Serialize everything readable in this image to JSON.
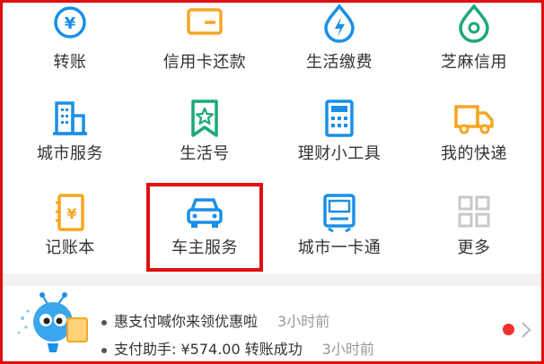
{
  "colors": {
    "accent_blue": "#1a8fe8",
    "accent_orange": "#f5a623",
    "accent_green": "#1aa97a",
    "highlight_red": "#e01010"
  },
  "grid": {
    "items": [
      {
        "label": "转账",
        "icon": "transfer-icon"
      },
      {
        "label": "信用卡还款",
        "icon": "credit-card-icon"
      },
      {
        "label": "生活缴费",
        "icon": "bolt-icon"
      },
      {
        "label": "芝麻信用",
        "icon": "sesame-credit-icon"
      },
      {
        "label": "城市服务",
        "icon": "city-building-icon"
      },
      {
        "label": "生活号",
        "icon": "bookmark-star-icon"
      },
      {
        "label": "理财小工具",
        "icon": "calculator-icon"
      },
      {
        "label": "我的快递",
        "icon": "delivery-truck-icon"
      },
      {
        "label": "记账本",
        "icon": "ledger-book-icon"
      },
      {
        "label": "车主服务",
        "icon": "car-icon"
      },
      {
        "label": "城市一卡通",
        "icon": "transit-card-icon"
      },
      {
        "label": "更多",
        "icon": "more-grid-icon"
      }
    ]
  },
  "notice": {
    "mascot_icon": "ant-mascot-icon",
    "line1": {
      "text": "惠支付喊你来领优惠啦",
      "time": "3小时前"
    },
    "line2": {
      "text": "支付助手: ¥574.00 转账成功",
      "time": "3小时前"
    }
  }
}
